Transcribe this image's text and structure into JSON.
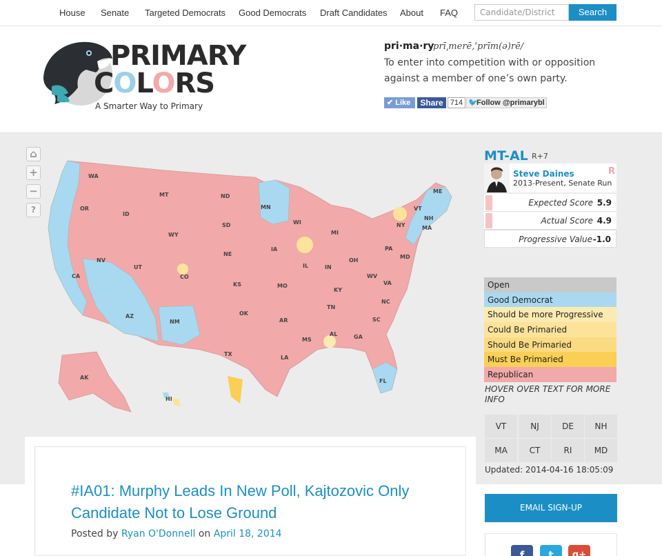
{
  "nav": {
    "items": [
      "House",
      "Senate",
      "Targeted Democrats",
      "Good Democrats",
      "Draft Candidates",
      "About",
      "FAQ"
    ],
    "search_placeholder": "Candidate/District",
    "search_button": "Search"
  },
  "logo": {
    "line1": "PRIMARY",
    "line2_parts": [
      "C",
      "O",
      "L",
      "O",
      "R",
      "S"
    ],
    "tagline": "A Smarter Way to Primary"
  },
  "definition": {
    "word": "pri·ma·ry",
    "pronunciation": "prī͵merē,ˈprīm(ə)rē/",
    "text": "To enter into competition with or opposition against a member of one’s own party."
  },
  "social": {
    "like": "Like",
    "share": "Share",
    "count": "714",
    "follow": "Follow @primarybl"
  },
  "map_controls": [
    "home-icon",
    "zoom-in-icon",
    "zoom-out-icon",
    "help-icon"
  ],
  "map_labels": [
    "WA",
    "OR",
    "CA",
    "NV",
    "ID",
    "MT",
    "WY",
    "UT",
    "AZ",
    "CO",
    "NM",
    "ND",
    "SD",
    "NE",
    "KS",
    "OK",
    "TX",
    "MN",
    "IA",
    "MO",
    "AR",
    "LA",
    "WI",
    "IL",
    "MI",
    "IN",
    "KY",
    "TN",
    "MS",
    "AL",
    "GA",
    "FL",
    "SC",
    "NC",
    "VA",
    "WV",
    "OH",
    "PA",
    "NY",
    "ME",
    "VT",
    "NH",
    "MA",
    "MD",
    "AK",
    "HI"
  ],
  "district": {
    "code": "MT-AL",
    "lean": "R+7",
    "rep_name": "Steve Daines",
    "rep_term": "2013-Present, Senate Run",
    "party": "R",
    "scores": [
      {
        "label": "Expected Score",
        "value": "5.9"
      },
      {
        "label": "Actual Score",
        "value": "4.9"
      },
      {
        "label": "Progressive Value",
        "value": "-1.0"
      }
    ]
  },
  "legend": [
    {
      "label": "Open",
      "color": "#c9c9c9"
    },
    {
      "label": "Good Democrat",
      "color": "#a9d9f0"
    },
    {
      "label": "Should be more Progressive",
      "color": "#fdeab0"
    },
    {
      "label": "Could Be Primaried",
      "color": "#fde39a"
    },
    {
      "label": "Should Be Primaried",
      "color": "#fbdb82"
    },
    {
      "label": "Must Be Primaried",
      "color": "#f9cf55"
    },
    {
      "label": "Republican",
      "color": "#f2a9a9"
    }
  ],
  "hover_note": "HOVER OVER TEXT FOR MORE INFO",
  "states_row1": [
    "VT",
    "NJ",
    "DE",
    "NH"
  ],
  "states_row2": [
    "MA",
    "CT",
    "RI",
    "MD"
  ],
  "updated": "Updated: 2014-04-16 18:05:09",
  "article": {
    "title": "#IA01: Murphy Leads In New Poll, Kajtozovic Only Candidate Not to Lose Ground",
    "posted_by": "Posted by",
    "author": "Ryan O'Donnell",
    "on": "on",
    "date": "April 18, 2014"
  },
  "email_signup": "EMAIL SIGN-UP",
  "share_buttons": [
    "f",
    "t",
    "g+"
  ],
  "colors": {
    "accent": "#1b8fc5",
    "republican": "#f2a9a9",
    "good_democrat": "#a9d9f0"
  }
}
